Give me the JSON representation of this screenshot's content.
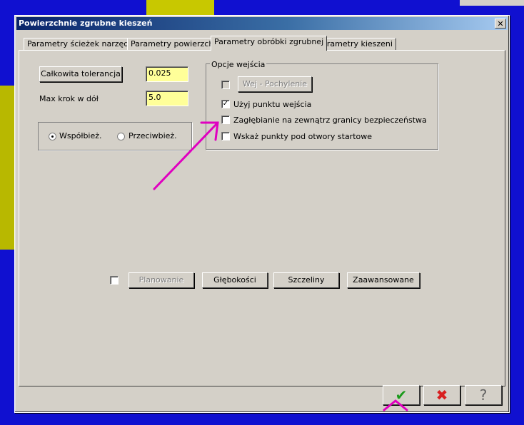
{
  "window": {
    "title": "Powierzchnie zgrubne kieszeń",
    "close_glyph": "✕"
  },
  "tabs": [
    {
      "label": "Parametry ścieżek narzędzia",
      "active": false
    },
    {
      "label": "Parametry powierzchni",
      "active": false
    },
    {
      "label": "Parametry obróbki zgrubnej",
      "active": true
    },
    {
      "label": "Parametry kieszeni",
      "active": false
    }
  ],
  "left": {
    "tolerance_button": "Całkowita tolerancja",
    "tolerance_value": "0.025",
    "max_step_label": "Max krok w dół",
    "max_step_value": "5.0",
    "radio_climb": "Współbież.",
    "radio_conventional": "Przeciwbież."
  },
  "entry": {
    "group_label": "Opcje wejścia",
    "ramp_button": "Wej - Pochylenie",
    "use_entry_point": "Użyj punktu wejścia",
    "plunge_outside": "Zagłębianie na zewnątrz granicy bezpieczeństwa",
    "show_points": "Wskaż punkty pod otwory startowe",
    "checked_glyph": "✓"
  },
  "bottom_buttons": {
    "facing": "Planowanie",
    "depths": "Głębokości",
    "gaps": "Szczeliny",
    "advanced": "Zaawansowane"
  },
  "footer": {
    "ok_icon": "check-icon",
    "cancel_icon": "x-icon",
    "help_icon": "help-icon",
    "ok_glyph": "✔",
    "cancel_glyph": "✖",
    "help_glyph": "?"
  },
  "colors": {
    "dialog_bg": "#d4d0c8",
    "field_bg": "#ffff99",
    "title_start": "#0a246a",
    "annotation": "#e000c0",
    "ok_green": "#1a9a1a",
    "cancel_red": "#d82020"
  }
}
